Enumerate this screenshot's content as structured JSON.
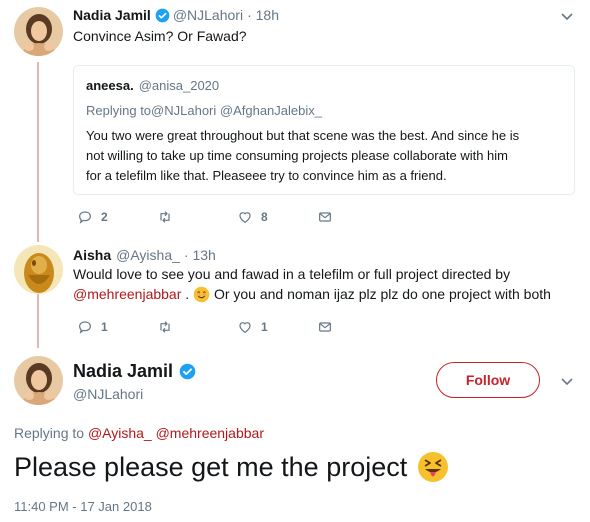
{
  "tweet1": {
    "name": "Nadia Jamil",
    "handle": "@NJLahori",
    "time": "· 18h",
    "text": "Convince Asim? Or Fawad?",
    "quote": {
      "name": "aneesa.",
      "handle": "@anisa_2020",
      "replying_prefix": "Replying to ",
      "replying_mentions": "@NJLahori @AfghanJalebix_",
      "lines": [
        "You two were great throughout but that scene was the best. And since he is",
        "not willing to take up time consuming projects please collaborate with him",
        "for a telefilm like that. Pleaseee try to convince him as a friend."
      ]
    },
    "actions": {
      "replies": "2",
      "retweets": "",
      "likes": "8"
    }
  },
  "tweet2": {
    "name": "Aisha",
    "handle": "@Ayisha_",
    "time": "· 13h",
    "line1": "Would love to see you and fawad in a telefilm or full project directed by",
    "mention": "@mehreenjabbar",
    "line2_mid": " . ",
    "line2_rest": " Or you and noman ijaz plz plz do one project with both",
    "actions": {
      "replies": "1",
      "retweets": "",
      "likes": "1"
    }
  },
  "main_tweet": {
    "name": "Nadia Jamil",
    "handle": "@NJLahori",
    "follow_label": "Follow",
    "replying_prefix": "Replying to ",
    "replying_mentions": "@Ayisha_ @mehreenjabbar",
    "text": "Please please get me the project",
    "timestamp": "11:40 PM - 17 Jan 2018"
  },
  "colors": {
    "accent": "#c7222a",
    "mention": "#b0191d",
    "verified": "#1da1f2",
    "thread_line": "#e1b8b8"
  },
  "icons": [
    "verified-badge-icon",
    "chevron-down-icon",
    "reply-icon",
    "retweet-icon",
    "like-icon",
    "message-icon",
    "smiling-face-emoji",
    "squinting-tongue-emoji"
  ]
}
